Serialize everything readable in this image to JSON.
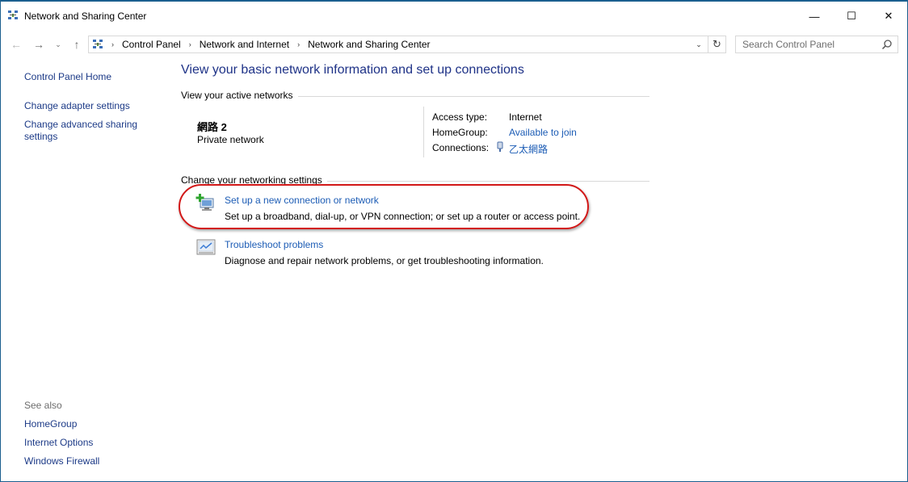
{
  "window": {
    "title": "Network and Sharing Center",
    "minimize_glyph": "—",
    "maximize_glyph": "☐",
    "close_glyph": "✕"
  },
  "nav": {
    "back_glyph": "←",
    "forward_glyph": "→",
    "recent_glyph": "⌄",
    "up_glyph": "↑",
    "breadcrumbs": [
      "Control Panel",
      "Network and Internet",
      "Network and Sharing Center"
    ],
    "separator_glyph": "›",
    "dropdown_glyph": "⌄",
    "refresh_glyph": "↻",
    "search_placeholder": "Search Control Panel"
  },
  "sidebar": {
    "home": "Control Panel Home",
    "adapter": "Change adapter settings",
    "advanced": "Change advanced sharing settings",
    "see_also_label": "See also",
    "see_also": [
      "HomeGroup",
      "Internet Options",
      "Windows Firewall"
    ]
  },
  "main": {
    "title": "View your basic network information and set up connections",
    "active_networks_label": "View your active networks",
    "network": {
      "name": "網路 2",
      "type": "Private network",
      "access_type_label": "Access type:",
      "access_type_value": "Internet",
      "homegroup_label": "HomeGroup:",
      "homegroup_value": "Available to join",
      "connections_label": "Connections:",
      "connections_value": "乙太網路"
    },
    "change_settings_label": "Change your networking settings",
    "tasks": [
      {
        "icon": "new-connection-icon",
        "link": "Set up a new connection or network",
        "desc": "Set up a broadband, dial-up, or VPN connection; or set up a router or access point."
      },
      {
        "icon": "troubleshoot-icon",
        "link": "Troubleshoot problems",
        "desc": "Diagnose and repair network problems, or get troubleshooting information."
      }
    ]
  },
  "colors": {
    "link": "#1c5cb5",
    "nav_link": "#1c3a87",
    "title": "#1e3287",
    "highlight": "#d21818"
  }
}
